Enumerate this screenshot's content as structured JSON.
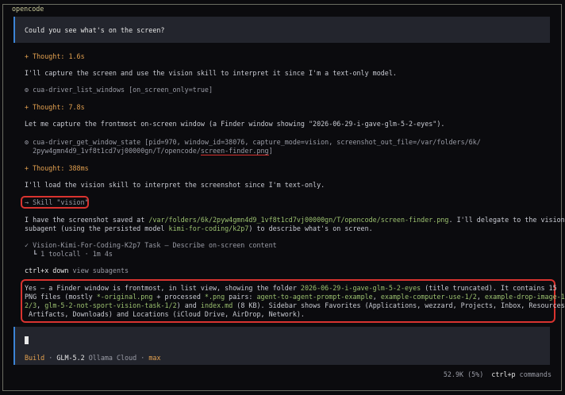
{
  "app": {
    "title": "opencode"
  },
  "user_message": "Could you see what's on the screen?",
  "thought1": "+ Thought: 1.6s",
  "reply1": "I'll capture the screen and use the vision skill to interpret it since I'm a text-only model.",
  "tool1": "⚙ cua-driver_list_windows [on_screen_only=true]",
  "thought2": "+ Thought: 7.8s",
  "reply2": "Let me capture the frontmost on-screen window (a Finder window showing \"2026-06-29-i-gave-glm-5-2-eyes\").",
  "tool2_line1": "⚙ cua-driver_get_window_state [pid=970, window_id=38076, capture_mode=vision, screenshot_out_file=/var/folders/6k/",
  "tool2_line2_pre": "  2pyw4gmn4d9_1vf8t1cd7vj00000gn/T/opencode/",
  "tool2_line2_file": "screen-finder.png",
  "tool2_line2_post": "]",
  "thought3": "+ Thought: 388ms",
  "reply3": "I'll load the vision skill to interpret the screenshot since I'm text-only.",
  "skill_label": "→ Skill \"vision\"",
  "reply4": {
    "a": "I have the screenshot saved at ",
    "path": "/var/folders/6k/2pyw4gmn4d9_1vf8t1cd7vj00000gn/T/opencode/screen-finder.png",
    "b": ". I'll delegate to the vision",
    "c": "subagent (using the persisted model ",
    "model": "kimi-for-coding/k2p7",
    "d": ") to describe what's on screen."
  },
  "task_line": "✓ Vision-Kimi-For-Coding-K2p7 Task — Describe on-screen content",
  "task_sub": "  ┗ 1 toolcall · 1m 4s",
  "subagent_hint": {
    "key": "ctrl+x down",
    "text": " view subagents"
  },
  "answer": {
    "l1a": "Yes — a Finder window is frontmost, in list view, showing the folder ",
    "folder": "2026-06-29-i-gave-glm-5-2-eyes",
    "l1b": " (title truncated). It contains 15",
    "l2a": "PNG files (mostly ",
    "g1": "*-original.png",
    "l2b": " + processed ",
    "g2": "*.png",
    "l2c": " pairs: ",
    "g3": "agent-to-agent-prompt-example",
    "l2d": ", ",
    "g4": "example-computer-use-1/2",
    "l2e": ", ",
    "g5": "example-drop-image-1/",
    "l3a": "2/3",
    "l3b": ", ",
    "g6": "glm-5-2-not-sport-vision-task-1/2",
    "l3c": ") and ",
    "g7": "index.md",
    "l3d": " (8 KB). Sidebar shows Favorites (Applications, wezzard, Projects, Inbox, Resources,",
    "l4": " Artifacts, Downloads) and Locations (iCloud Drive, AirDrop, Network)."
  },
  "footer": {
    "mode": "Build",
    "sep": " · ",
    "model": "GLM-5.2",
    "provider": "Ollama Cloud",
    "variant": "max"
  },
  "status": {
    "tokens": "52.9K (5%)",
    "shortcut": "ctrl+p",
    "shortcut_label": "commands"
  }
}
